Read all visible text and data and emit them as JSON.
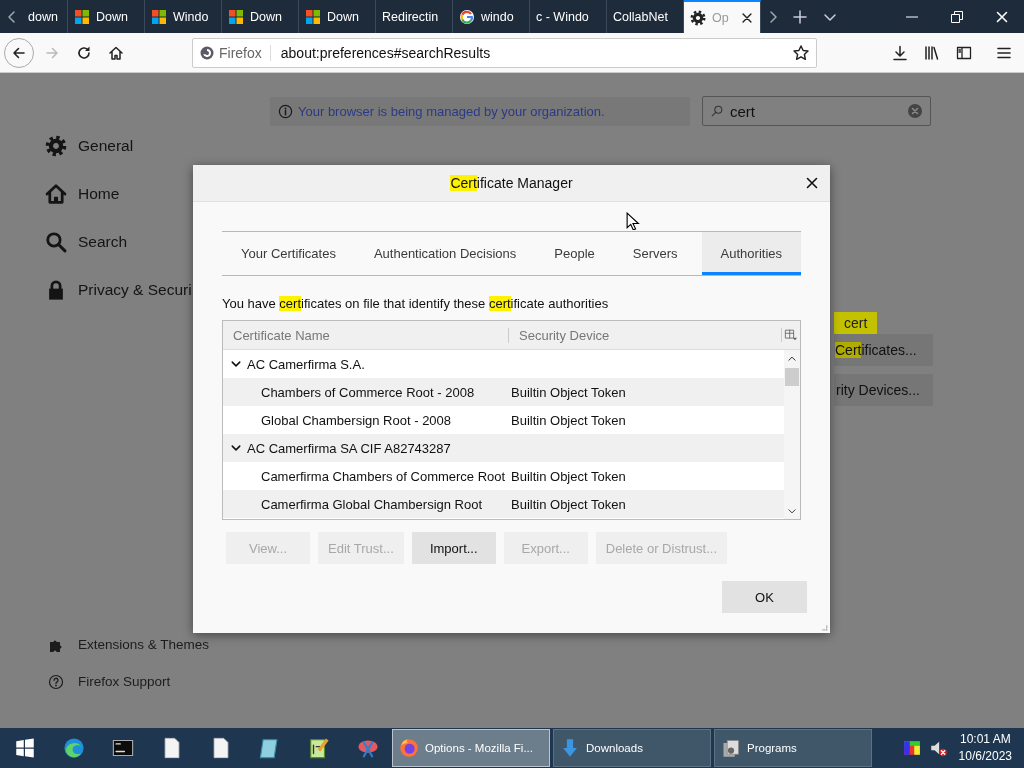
{
  "tab_strip": {
    "tabs": [
      {
        "label": "down",
        "kind": "plain",
        "selected": false
      },
      {
        "label": "Down",
        "kind": "windows",
        "selected": false
      },
      {
        "label": "Windo",
        "kind": "windows",
        "selected": false
      },
      {
        "label": "Down",
        "kind": "windows",
        "selected": false
      },
      {
        "label": "Down",
        "kind": "windows",
        "selected": false
      },
      {
        "label": "Redirectin",
        "kind": "plain",
        "selected": false
      },
      {
        "label": "windo",
        "kind": "google",
        "selected": false
      },
      {
        "label": "c - Windo",
        "kind": "plain",
        "selected": false
      },
      {
        "label": "CollabNet",
        "kind": "plain",
        "selected": false
      },
      {
        "label": "Op",
        "kind": "settings",
        "selected": true
      }
    ]
  },
  "toolbar": {
    "forward_disabled": true,
    "identity": "Firefox",
    "url": "about:preferences#searchResults"
  },
  "preferences": {
    "notice": "Your browser is being managed by your organization.",
    "search": {
      "value": "cert"
    },
    "categories": [
      {
        "label": "General",
        "kind": "gear"
      },
      {
        "label": "Home",
        "kind": "home"
      },
      {
        "label": "Search",
        "kind": "search"
      },
      {
        "label": "Privacy & Securi",
        "kind": "lock"
      }
    ],
    "footer_links": [
      {
        "label": "Extensions & Themes",
        "kind": "puzzle"
      },
      {
        "label": "Firefox Support",
        "kind": "help"
      }
    ],
    "search_tooltip": "cert",
    "buttons": [
      [
        {
          "text": "Cert",
          "highlight": true
        },
        {
          "text": "ificates...",
          "highlight": false
        }
      ],
      [
        {
          "text": "rity Devices...",
          "highlight": false
        }
      ]
    ]
  },
  "dialog": {
    "title": [
      {
        "text": "Cert",
        "highlight": true
      },
      {
        "text": "ificate Manager",
        "highlight": false
      }
    ],
    "tabs": [
      {
        "label": "Your Certificates",
        "selected": false
      },
      {
        "label": "Authentication Decisions",
        "selected": false
      },
      {
        "label": "People",
        "selected": false
      },
      {
        "label": "Servers",
        "selected": false
      },
      {
        "label": "Authorities",
        "selected": true
      }
    ],
    "description": [
      {
        "text": "You have ",
        "highlight": false
      },
      {
        "text": "cert",
        "highlight": true
      },
      {
        "text": "ificates on file that identify these ",
        "highlight": false
      },
      {
        "text": "cert",
        "highlight": true
      },
      {
        "text": "ificate authorities",
        "highlight": false
      }
    ],
    "columns": [
      "Certificate Name",
      "Security Device"
    ],
    "tree": [
      {
        "name": "AC Camerfirma S.A.",
        "expanded": true,
        "children": [
          {
            "name": "Chambers of Commerce Root - 2008",
            "device": "Builtin Object Token"
          },
          {
            "name": "Global Chambersign Root - 2008",
            "device": "Builtin Object Token"
          }
        ]
      },
      {
        "name": "AC Camerfirma SA CIF A82743287",
        "expanded": true,
        "children": [
          {
            "name": "Camerfirma Chambers of Commerce Root",
            "device": "Builtin Object Token"
          },
          {
            "name": "Camerfirma Global Chambersign Root",
            "device": "Builtin Object Token"
          }
        ]
      }
    ],
    "buttons": [
      {
        "label": "View...",
        "disabled": true
      },
      {
        "label": "Edit Trust...",
        "disabled": true
      },
      {
        "label": "Import...",
        "disabled": false
      },
      {
        "label": "Export...",
        "disabled": true
      },
      {
        "label": "Delete or Distrust...",
        "disabled": true
      }
    ],
    "ok": "OK"
  },
  "taskbar": {
    "pinned": [
      {
        "kind": "start"
      },
      {
        "kind": "browser"
      },
      {
        "kind": "terminal"
      },
      {
        "kind": "document"
      },
      {
        "kind": "document"
      },
      {
        "kind": "notes"
      },
      {
        "kind": "editor"
      },
      {
        "kind": "snip"
      }
    ],
    "windows": [
      {
        "label": "Options - Mozilla Fi...",
        "kind": "firefox",
        "selected": true
      },
      {
        "label": "Downloads",
        "kind": "download",
        "selected": false
      },
      {
        "label": "Programs",
        "kind": "programs",
        "selected": false
      }
    ],
    "tray": {
      "muted": true,
      "time": "10:01 AM",
      "date": "10/6/2023"
    }
  }
}
